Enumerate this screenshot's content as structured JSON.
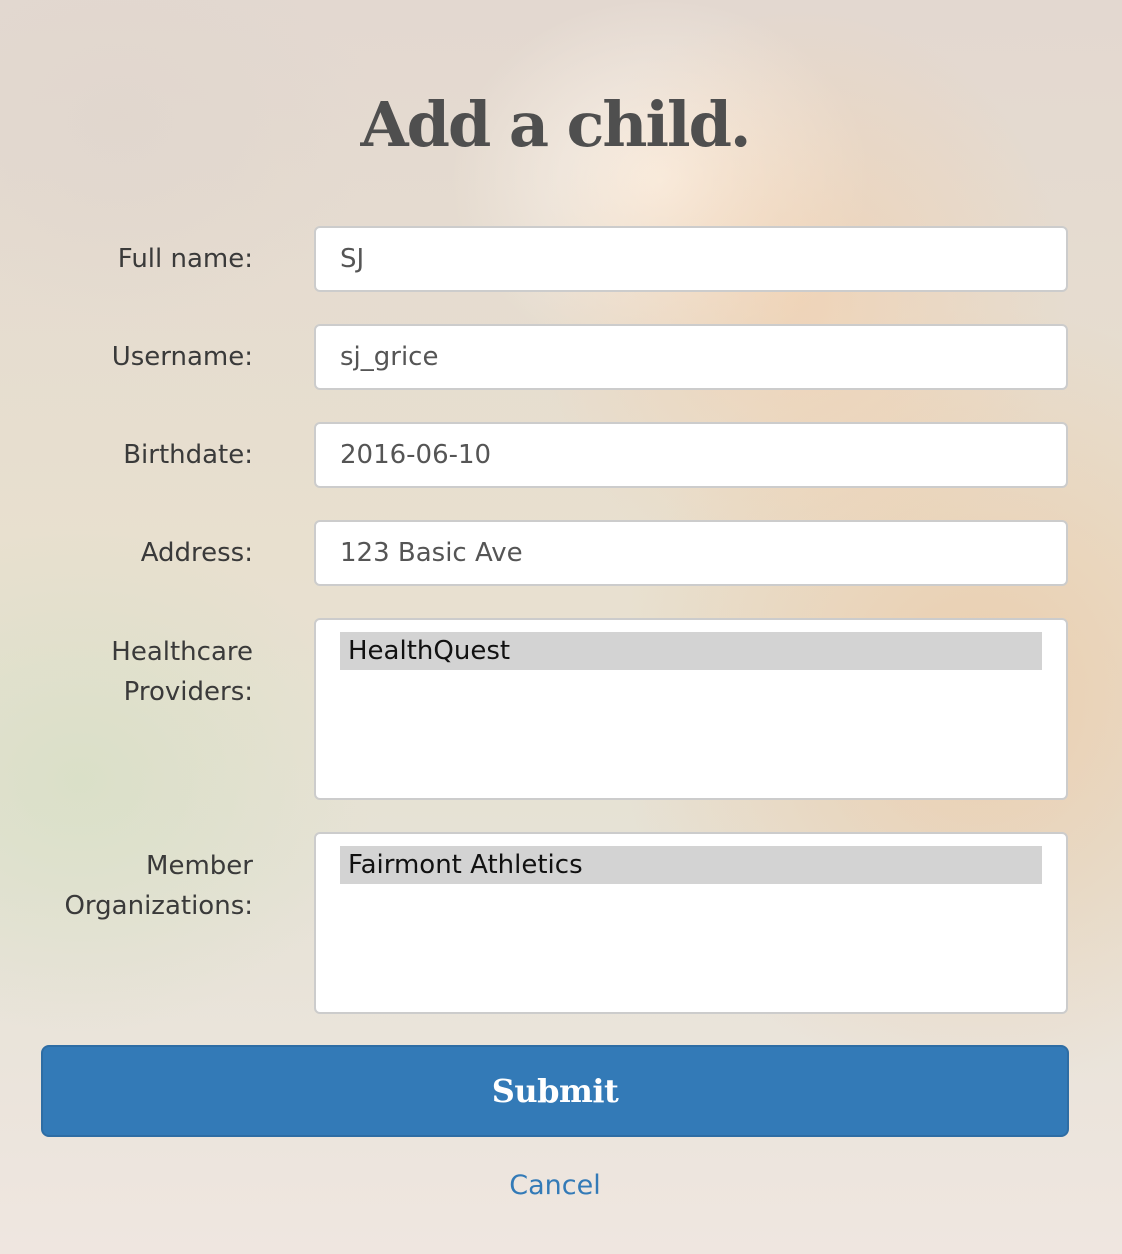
{
  "title": "Add a child.",
  "fields": {
    "full_name": {
      "label": "Full name:",
      "value": "SJ"
    },
    "username": {
      "label": "Username:",
      "value": "sj_grice"
    },
    "birthdate": {
      "label": "Birthdate:",
      "value": "2016-06-10"
    },
    "address": {
      "label": "Address:",
      "value": "123 Basic Ave"
    }
  },
  "healthcare_providers": {
    "label_line1": "Healthcare",
    "label_line2": "Providers:",
    "options": [
      "HealthQuest"
    ]
  },
  "member_organizations": {
    "label_line1": "Member",
    "label_line2": "Organizations:",
    "options": [
      "Fairmont Athletics"
    ]
  },
  "submit_label": "Submit",
  "cancel_label": "Cancel",
  "colors": {
    "primary": "#337ab7",
    "selected_option_bg": "#d3d3d3",
    "title": "#4f4f4f"
  }
}
